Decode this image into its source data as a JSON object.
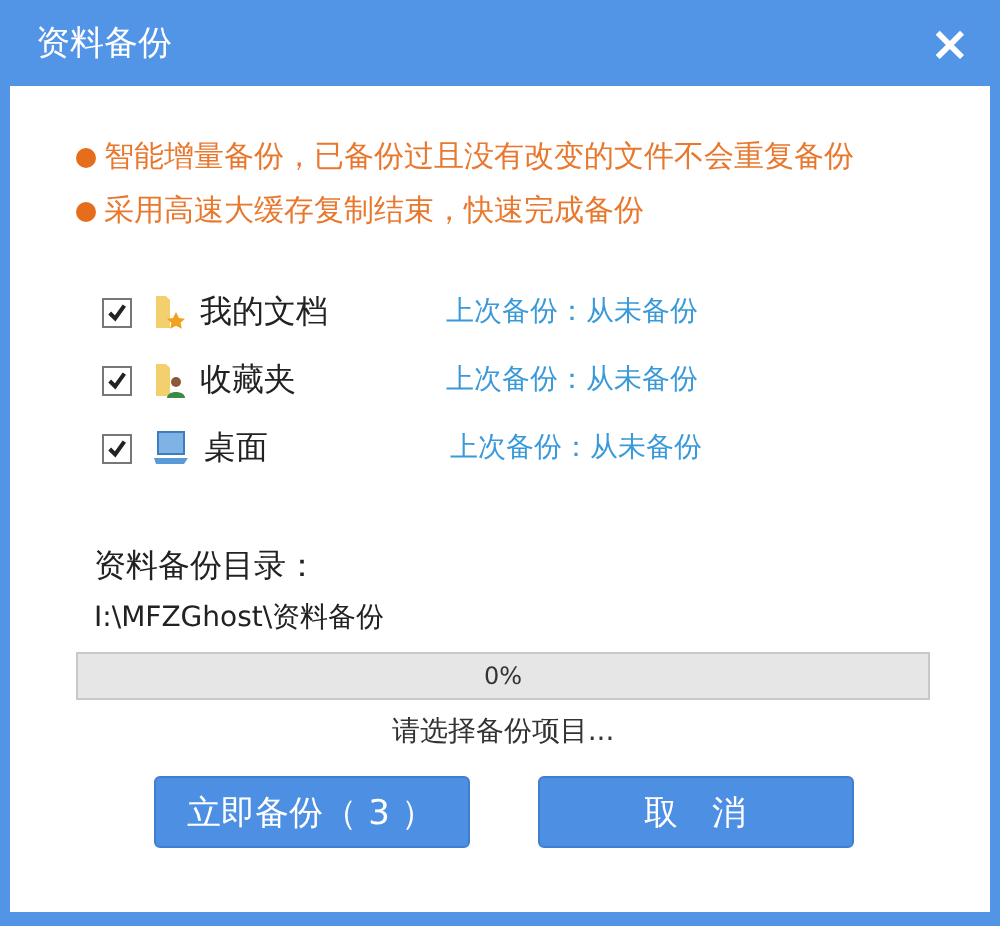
{
  "window": {
    "title": "资料备份",
    "close": "×"
  },
  "notes": [
    "智能增量备份，已备份过且没有改变的文件不会重复备份",
    "采用高速大缓存复制结束，快速完成备份"
  ],
  "items": [
    {
      "kind": "documents",
      "label": "我的文档",
      "checked": true,
      "status": "上次备份：从未备份"
    },
    {
      "kind": "favorites",
      "label": "收藏夹",
      "checked": true,
      "status": "上次备份：从未备份"
    },
    {
      "kind": "desktop",
      "label": "桌面",
      "checked": true,
      "status": "上次备份：从未备份"
    }
  ],
  "directory": {
    "label": "资料备份目录：",
    "path": "I:\\MFZGhost\\资料备份"
  },
  "progress": {
    "level": 0,
    "reading": "0%"
  },
  "status": "请选择备份项目...",
  "buttons": [
    "立即备份（ 3 ）",
    "取　消"
  ]
}
